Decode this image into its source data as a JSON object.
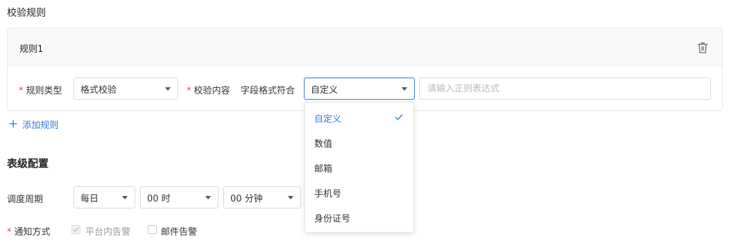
{
  "section_title": "校验规则",
  "rule": {
    "name": "规则1",
    "type_label": "规则类型",
    "type_value": "格式校验",
    "content_label": "校验内容",
    "format_label": "字段格式符合",
    "format_value": "自定义",
    "regex_placeholder": "请输入正则表达式"
  },
  "format_options": [
    "自定义",
    "数值",
    "邮箱",
    "手机号",
    "身份证号"
  ],
  "add_rule_label": "添加规则",
  "table_config": {
    "title": "表级配置",
    "schedule_label": "调度周期",
    "period_value": "每日",
    "hour_value": "00 时",
    "minute_value": "00 分钟"
  },
  "notify": {
    "label": "通知方式",
    "platform_alert": "平台内告警",
    "email_alert": "邮件告警"
  },
  "colors": {
    "accent": "#2f7bd9",
    "required": "#f04134"
  }
}
